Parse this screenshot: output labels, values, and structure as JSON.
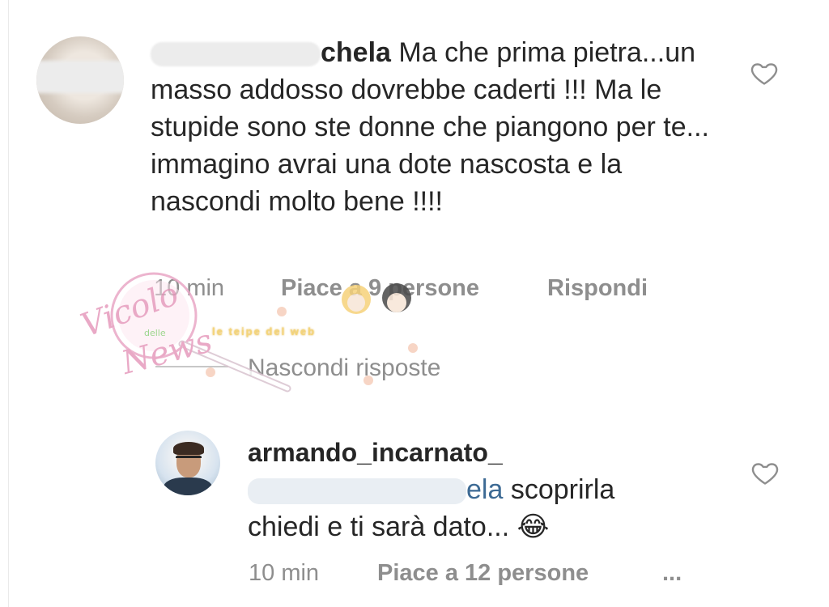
{
  "comment1": {
    "username_visible": "chela",
    "text": "Ma che prima pietra...un masso addosso dovrebbe caderti !!! Ma le stupide sono ste donne che piangono per te... immagino avrai una dote nascosta e la nascondi molto bene !!!!",
    "time": "10 min",
    "likes": "Piace a 9 persone",
    "reply_label": "Rispondi",
    "hide_replies": "Nascondi risposte"
  },
  "reply": {
    "username": "armando_incarnato_",
    "mention_visible": "ela",
    "text_line1": "scoprirla",
    "text_line2": "chiedi e ti sarà dato...",
    "emoji": "😂",
    "time": "10 min",
    "likes": "Piace a 12 persone",
    "more_label": "..."
  },
  "watermark": {
    "logo_line1": "Vicolo",
    "logo_line2": "delle",
    "logo_line3": "News",
    "tagline": "le teipe del web"
  },
  "icons": {
    "like": "heart-outline-icon"
  },
  "colors": {
    "text": "#262626",
    "meta": "#8e8e8e",
    "mention": "#3d6a94",
    "watermark_pink": "#e9a8c6"
  }
}
